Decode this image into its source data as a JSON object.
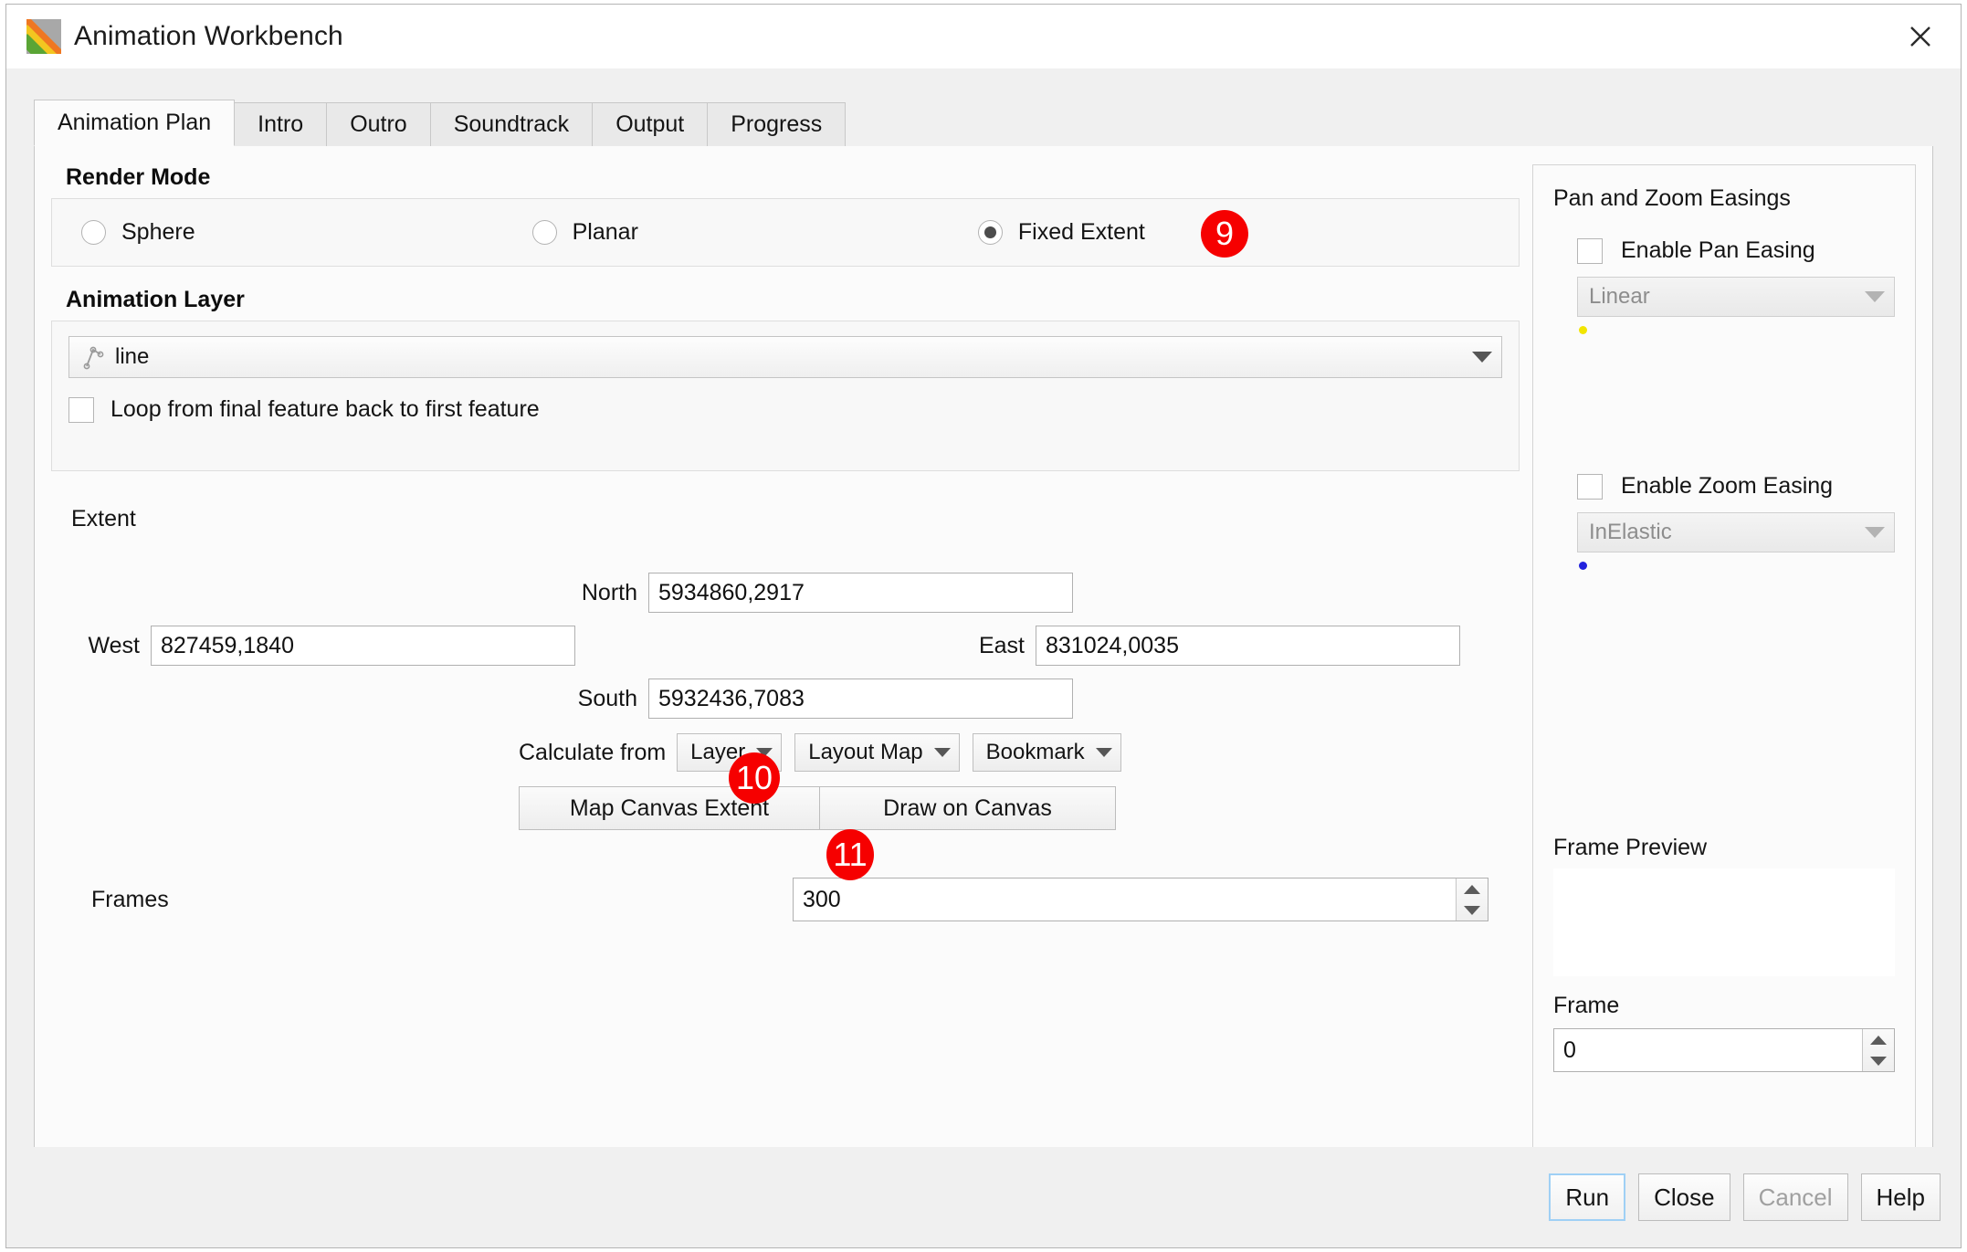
{
  "window": {
    "title": "Animation Workbench",
    "app_icon": "qgis-animation-icon",
    "close_icon": "close-icon"
  },
  "tabs": [
    {
      "label": "Animation Plan",
      "active": true
    },
    {
      "label": "Intro",
      "active": false
    },
    {
      "label": "Outro",
      "active": false
    },
    {
      "label": "Soundtrack",
      "active": false
    },
    {
      "label": "Output",
      "active": false
    },
    {
      "label": "Progress",
      "active": false
    }
  ],
  "render_mode": {
    "title": "Render Mode",
    "options": [
      {
        "label": "Sphere",
        "checked": false
      },
      {
        "label": "Planar",
        "checked": false
      },
      {
        "label": "Fixed Extent",
        "checked": true
      }
    ]
  },
  "animation_layer": {
    "title": "Animation Layer",
    "layer_value": "line",
    "layer_icon": "line-layer-icon",
    "loop_label": "Loop from final feature back to first feature",
    "loop_checked": false
  },
  "extent": {
    "label": "Extent",
    "north_label": "North",
    "north_value": "5934860,2917",
    "west_label": "West",
    "west_value": "827459,1840",
    "east_label": "East",
    "east_value": "831024,0035",
    "south_label": "South",
    "south_value": "5932436,7083",
    "calculate_from_label": "Calculate from",
    "calc_options": [
      "Layer",
      "Layout Map",
      "Bookmark"
    ],
    "map_canvas_extent_label": "Map Canvas Extent",
    "draw_on_canvas_label": "Draw on Canvas"
  },
  "frames": {
    "label": "Frames",
    "value": "300"
  },
  "easings": {
    "title": "Pan and Zoom Easings",
    "pan": {
      "checkbox_label": "Enable Pan Easing",
      "checked": false,
      "selected": "Linear",
      "dot_color": "#f2e500"
    },
    "zoom": {
      "checkbox_label": "Enable Zoom Easing",
      "checked": false,
      "selected": "InElastic",
      "dot_color": "#2222dd"
    },
    "frame_preview_title": "Frame Preview",
    "frame_title": "Frame",
    "frame_value": "0"
  },
  "footer": {
    "run": "Run",
    "close": "Close",
    "cancel": "Cancel",
    "help": "Help"
  },
  "callouts": [
    {
      "id": "9",
      "target": "fixed-extent-radio"
    },
    {
      "id": "10",
      "target": "map-canvas-extent-button"
    },
    {
      "id": "11",
      "target": "frames-spinner"
    }
  ]
}
